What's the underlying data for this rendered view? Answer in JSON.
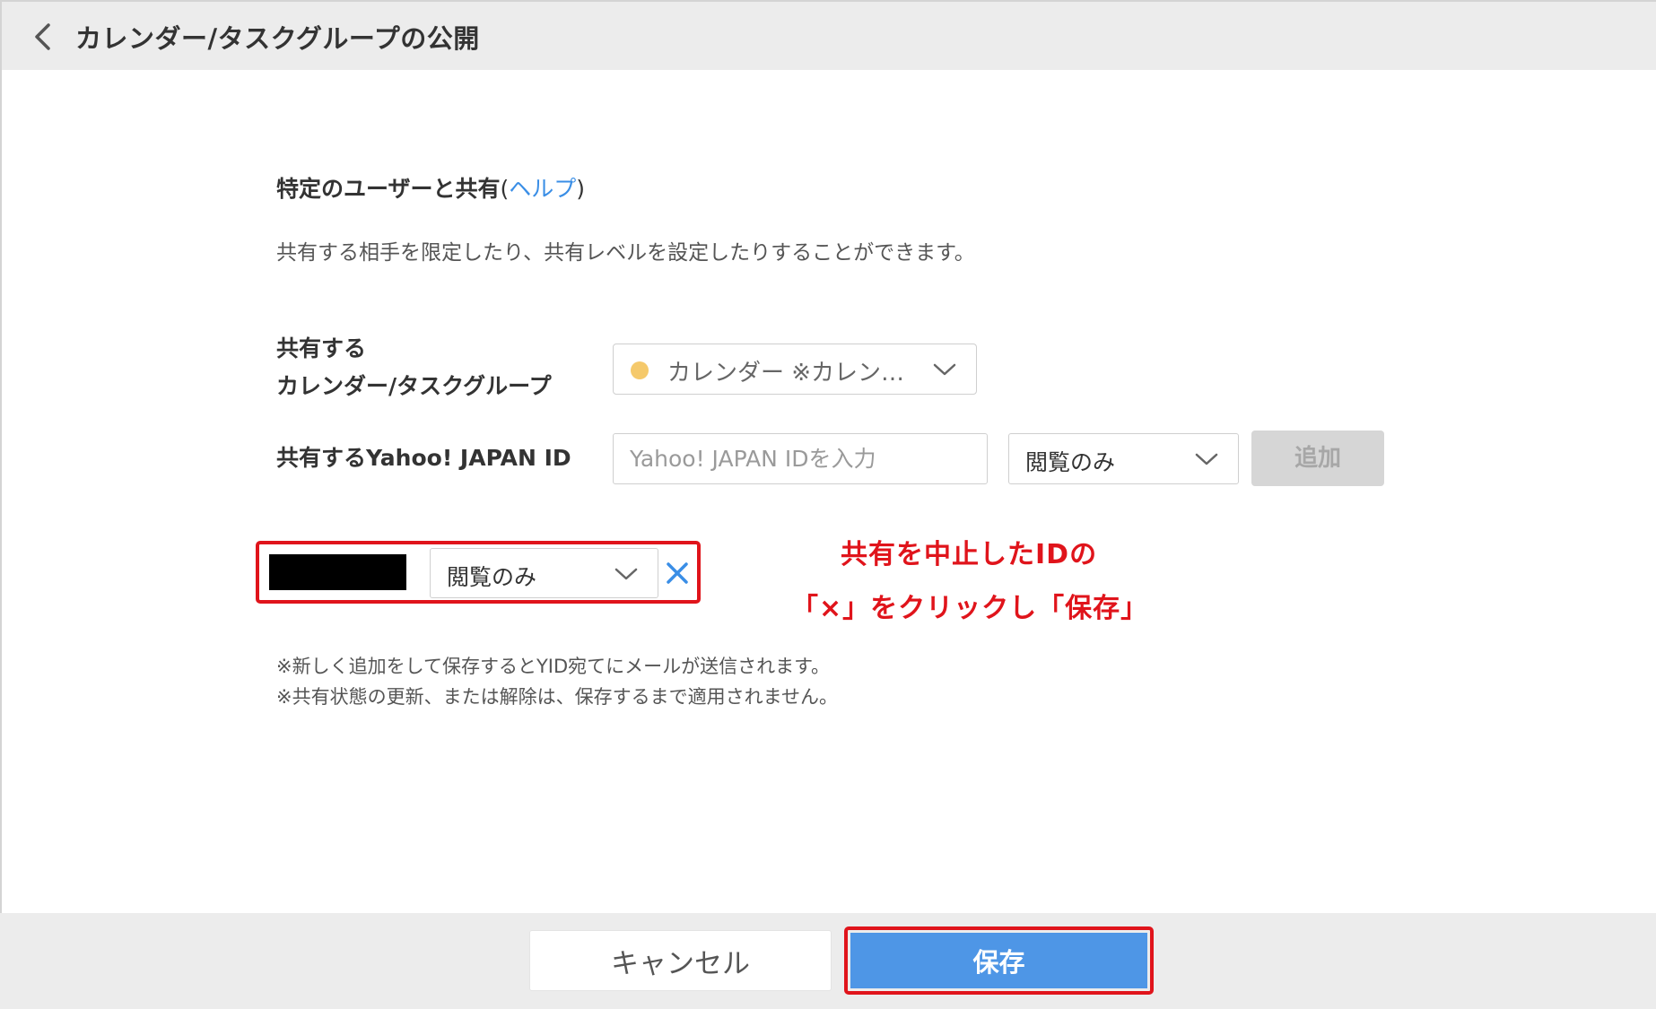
{
  "header": {
    "title": "カレンダー/タスクグループの公開",
    "back_icon": "chevron-left-icon"
  },
  "section": {
    "title": "特定のユーザーと共有",
    "help_open": "(",
    "help_link": "ヘルプ",
    "help_close": ")",
    "description": "共有する相手を限定したり、共有レベルを設定したりすることができます。"
  },
  "form": {
    "calendar_label_line1": "共有する",
    "calendar_label_line2": "カレンダー/タスクグループ",
    "calendar_value": "カレンダー ※カレン…",
    "calendar_dot_color": "#f5c96b",
    "yahoo_label": "共有するYahoo! JAPAN ID",
    "yahoo_placeholder": "Yahoo! JAPAN IDを入力",
    "level_value": "閲覧のみ",
    "add_label": "追加"
  },
  "shared_entries": [
    {
      "id_redacted": true,
      "level": "閲覧のみ",
      "remove_icon": "close-icon"
    }
  ],
  "annotation": {
    "line1": "共有を中止したIDの",
    "line2": "「×」をクリックし「保存」",
    "color": "#e0141b"
  },
  "notes": {
    "line1": "※新しく追加をして保存するとYID宛てにメールが送信されます。",
    "line2": "※共有状態の更新、または解除は、保存するまで適用されません。"
  },
  "footer": {
    "cancel_label": "キャンセル",
    "save_label": "保存",
    "save_color": "#4e96e6"
  }
}
